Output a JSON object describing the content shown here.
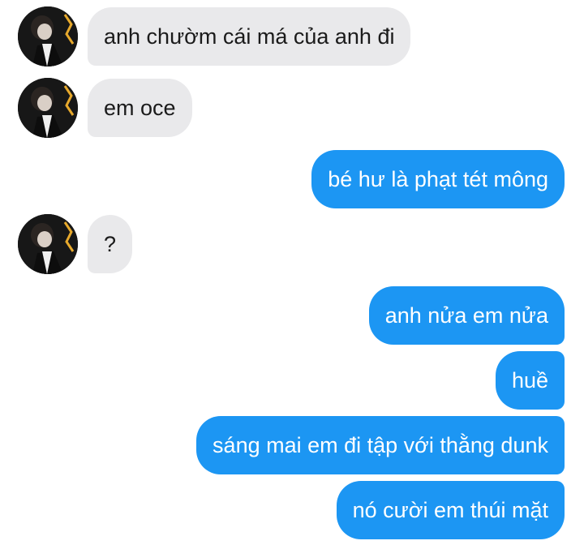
{
  "conversation": {
    "messages": [
      {
        "sender": "contact",
        "text": "anh chườm cái má của anh đi"
      },
      {
        "sender": "contact",
        "text": "em oce"
      },
      {
        "sender": "me",
        "text": "bé hư là phạt tét mông"
      },
      {
        "sender": "contact",
        "text": "?"
      },
      {
        "sender": "me",
        "text": "anh nửa em nửa"
      },
      {
        "sender": "me",
        "text": "huề"
      },
      {
        "sender": "me",
        "text": "sáng mai em đi tập với thằng dunk"
      },
      {
        "sender": "me",
        "text": "nó cười em thúi mặt"
      }
    ]
  },
  "colors": {
    "incoming_bubble": "#e9e9eb",
    "outgoing_bubble": "#1c96f3",
    "incoming_text": "#1b1b1b",
    "outgoing_text": "#ffffff"
  }
}
